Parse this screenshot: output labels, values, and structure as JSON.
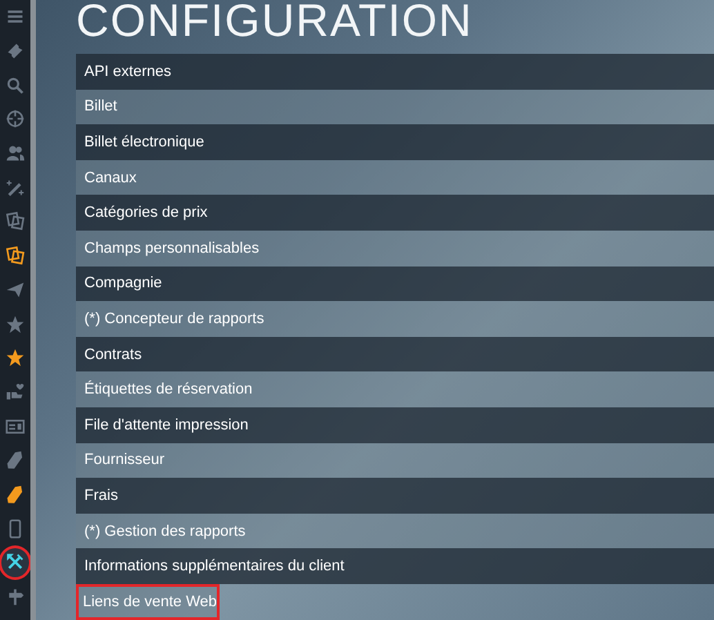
{
  "sidebar": {
    "items": [
      {
        "kind": "menu",
        "color": "#6b7683",
        "selected": false,
        "circled": false
      },
      {
        "kind": "ticket",
        "color": "#6b7683",
        "selected": false,
        "circled": false
      },
      {
        "kind": "search",
        "color": "#6b7683",
        "selected": false,
        "circled": false
      },
      {
        "kind": "crosshair",
        "color": "#6b7683",
        "selected": false,
        "circled": false
      },
      {
        "kind": "users",
        "color": "#6b7683",
        "selected": false,
        "circled": false
      },
      {
        "kind": "wand",
        "color": "#6b7683",
        "selected": false,
        "circled": false
      },
      {
        "kind": "copies",
        "color": "#6b7683",
        "selected": false,
        "circled": false
      },
      {
        "kind": "copies",
        "color": "#f39a1e",
        "selected": false,
        "circled": false
      },
      {
        "kind": "plane",
        "color": "#6b7683",
        "selected": false,
        "circled": false
      },
      {
        "kind": "star",
        "color": "#6b7683",
        "selected": false,
        "circled": false
      },
      {
        "kind": "star",
        "color": "#f39a1e",
        "selected": false,
        "circled": false
      },
      {
        "kind": "hand",
        "color": "#6b7683",
        "selected": false,
        "circled": false
      },
      {
        "kind": "card",
        "color": "#6b7683",
        "selected": false,
        "circled": false
      },
      {
        "kind": "tag",
        "color": "#6b7683",
        "selected": false,
        "circled": false
      },
      {
        "kind": "tag",
        "color": "#f39a1e",
        "selected": false,
        "circled": false
      },
      {
        "kind": "phone",
        "color": "#6b7683",
        "selected": false,
        "circled": false
      },
      {
        "kind": "tools",
        "color": "#45d3e6",
        "selected": true,
        "circled": true
      },
      {
        "kind": "signpost",
        "color": "#6b7683",
        "selected": false,
        "circled": false
      }
    ]
  },
  "title": "CONFIGURATION",
  "rows": [
    {
      "label": "API externes",
      "outlined": false
    },
    {
      "label": "Billet",
      "outlined": false
    },
    {
      "label": "Billet électronique",
      "outlined": false
    },
    {
      "label": "Canaux",
      "outlined": false
    },
    {
      "label": "Catégories de prix",
      "outlined": false
    },
    {
      "label": "Champs personnalisables",
      "outlined": false
    },
    {
      "label": "Compagnie",
      "outlined": false
    },
    {
      "label": "(*) Concepteur de rapports",
      "outlined": false
    },
    {
      "label": "Contrats",
      "outlined": false
    },
    {
      "label": "Étiquettes de réservation",
      "outlined": false
    },
    {
      "label": "File d'attente impression",
      "outlined": false
    },
    {
      "label": "Fournisseur",
      "outlined": false
    },
    {
      "label": "Frais",
      "outlined": false
    },
    {
      "label": "(*) Gestion des rapports",
      "outlined": false
    },
    {
      "label": "Informations supplémentaires du client",
      "outlined": false
    },
    {
      "label": "Liens de vente Web",
      "outlined": true
    }
  ]
}
